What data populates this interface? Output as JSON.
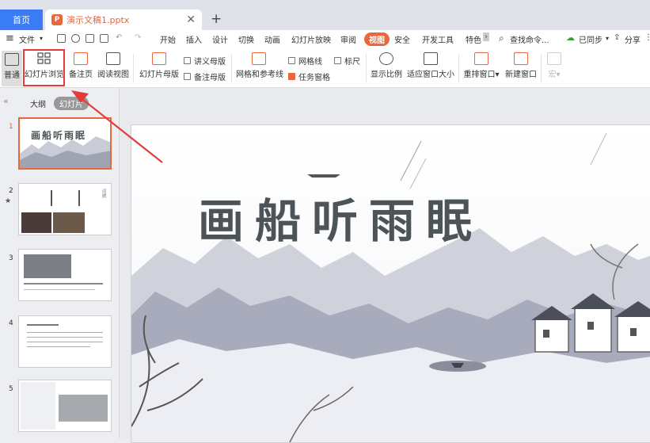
{
  "tabs": {
    "home": "首页",
    "document": "演示文稿1.pptx",
    "close": "✕",
    "new": "+"
  },
  "menu": {
    "hamburger": "≡",
    "file": "文件",
    "items": [
      "开始",
      "插入",
      "设计",
      "切换",
      "动画",
      "幻灯片放映",
      "审阅",
      "视图",
      "安全",
      "开发工具",
      "特色"
    ],
    "active": "视图",
    "search": "查找命令...",
    "sync": "已同步",
    "share": "分享"
  },
  "ribbon": {
    "normal": "普通",
    "slide_browse": "幻灯片浏览",
    "notes_page": "备注页",
    "reading_view": "阅读视图",
    "slide_master": "幻灯片母版",
    "handout_master": "讲义母版",
    "notes_master": "备注母版",
    "grid_guides": "网格和参考线",
    "gridlines": "网格线",
    "ruler": "标尺",
    "task_pane": "任务窗格",
    "zoom": "显示比例",
    "fit_window": "适应窗口大小",
    "arrange_window": "重排窗口",
    "new_window": "新建窗口",
    "macro": "宏"
  },
  "left_panel": {
    "collapse": "«",
    "outline_tab": "大纲",
    "slides_tab": "幻灯片",
    "slides": [
      {
        "number": "1",
        "selected": true,
        "title": "画船听雨眠"
      },
      {
        "number": "2",
        "selected": false,
        "star": "★",
        "label": "词牌"
      },
      {
        "number": "3",
        "selected": false
      },
      {
        "number": "4",
        "selected": false
      },
      {
        "number": "5",
        "selected": false
      }
    ]
  },
  "slide": {
    "title": "画船听雨眠"
  },
  "colors": {
    "accent": "#e8673c",
    "home_tab": "#3a7bf6",
    "annotation": "#e23c3c"
  }
}
